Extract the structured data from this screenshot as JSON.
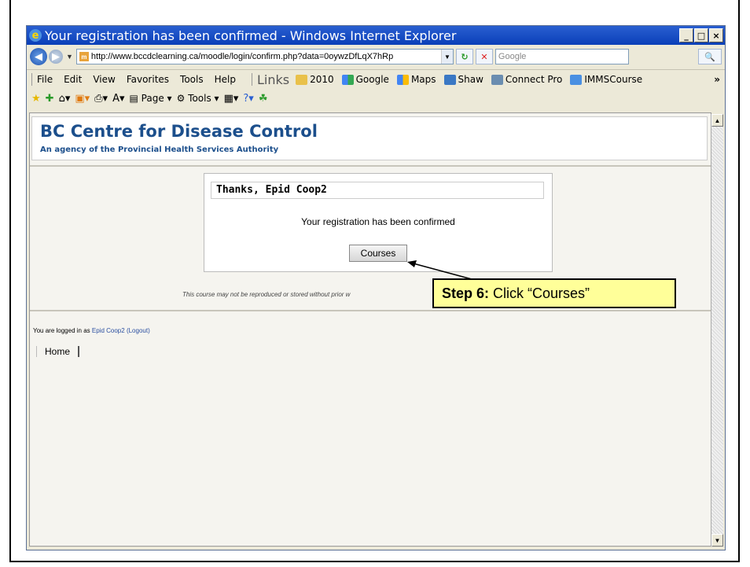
{
  "window": {
    "title": "Your registration has been confirmed - Windows Internet Explorer",
    "controls": [
      "_",
      "□",
      "×"
    ]
  },
  "address_bar": {
    "url": "http://www.bccdclearning.ca/moodle/login/confirm.php?data=0oywzDfLqX7hRp",
    "search_placeholder": "Google"
  },
  "menu": {
    "items": [
      "File",
      "Edit",
      "View",
      "Favorites",
      "Tools",
      "Help"
    ],
    "links_label": "Links",
    "links": [
      "2010",
      "Google",
      "Maps",
      "Shaw",
      "Connect Pro",
      "IMMSCourse"
    ],
    "more": "»"
  },
  "toolbar": {
    "page_label": "Page",
    "tools_label": "Tools"
  },
  "site": {
    "title": "BC Centre for Disease Control",
    "subtitle": "An agency of the Provincial Health Services Authority"
  },
  "confirm_box": {
    "heading": "Thanks, Epid Coop2",
    "message": "Your registration has been confirmed",
    "button_label": "Courses"
  },
  "notice": "This course may not be reproduced or stored without prior w",
  "footer": {
    "logged_in_prefix": "You are logged in as",
    "user": "Epid Coop2",
    "logout": "(Logout)",
    "home": "Home"
  },
  "callout": {
    "step": "Step 6:",
    "text": "Click “Courses”"
  }
}
